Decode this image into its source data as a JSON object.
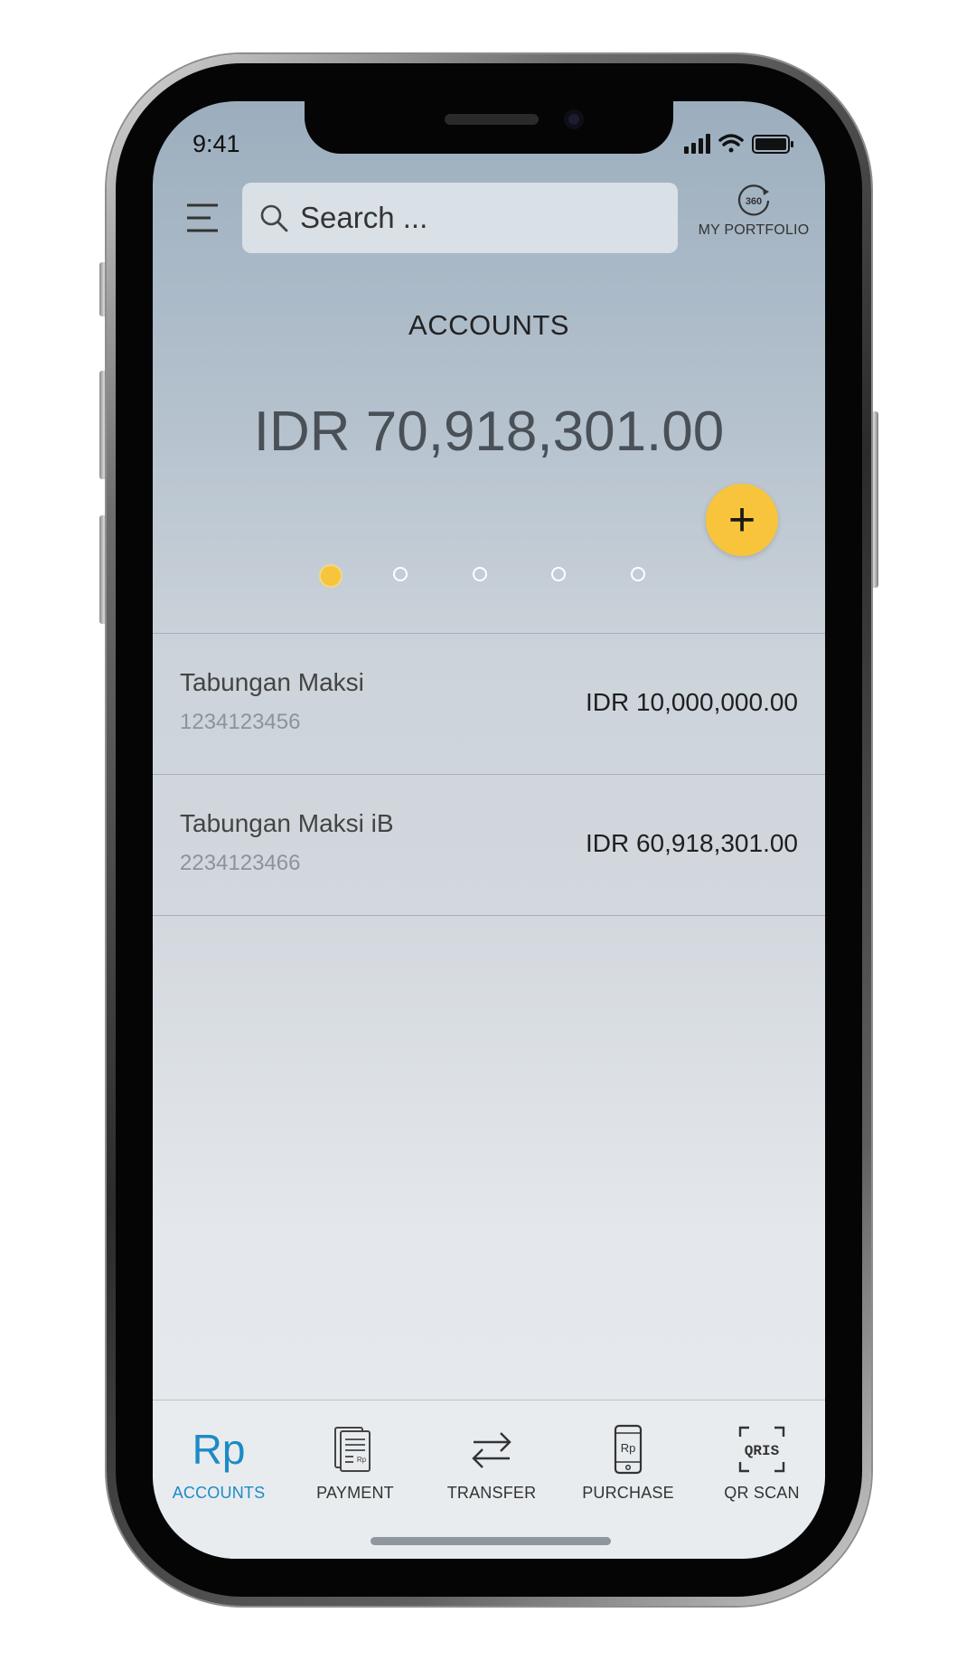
{
  "status_bar": {
    "time": "9:41"
  },
  "header": {
    "search_placeholder": "Search ...",
    "portfolio_icon_text": "360",
    "portfolio_label": "MY PORTFOLIO"
  },
  "summary": {
    "title": "ACCOUNTS",
    "total_balance": "IDR 70,918,301.00",
    "add_label": "+",
    "pager": {
      "pages": 5,
      "active_index": 0
    }
  },
  "accounts": [
    {
      "name": "Tabungan Maksi",
      "number": "1234123456",
      "balance": "IDR 10,000,000.00"
    },
    {
      "name": "Tabungan Maksi iB",
      "number": "2234123466",
      "balance": "IDR 60,918,301.00"
    }
  ],
  "tabbar": {
    "items": [
      {
        "label": "ACCOUNTS",
        "icon": "rupiah-icon",
        "icon_text": "Rp",
        "active": true
      },
      {
        "label": "PAYMENT",
        "icon": "bill-icon",
        "active": false
      },
      {
        "label": "TRANSFER",
        "icon": "transfer-arrows-icon",
        "active": false
      },
      {
        "label": "PURCHASE",
        "icon": "phone-rupiah-icon",
        "active": false
      },
      {
        "label": "QR SCAN",
        "icon": "qris-icon",
        "active": false
      }
    ]
  },
  "colors": {
    "accent_yellow": "#f8c43c",
    "active_tab_blue": "#1e8ac7",
    "screen_top": "#9caebe",
    "screen_bottom": "#e6eaee"
  }
}
